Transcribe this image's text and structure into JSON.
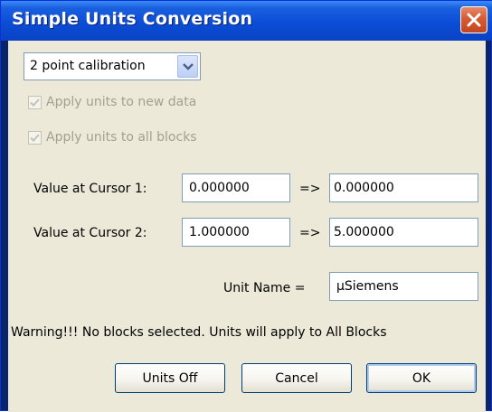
{
  "window": {
    "title": "Simple Units Conversion",
    "close_icon": "close-icon"
  },
  "calibration": {
    "selected": "2 point calibration",
    "dropdown_icon": "chevron-down-icon"
  },
  "options": {
    "apply_new_data": {
      "label": "Apply units to new data",
      "checked": true,
      "enabled": false
    },
    "apply_all_blocks": {
      "label": "Apply units to all blocks",
      "checked": true,
      "enabled": false
    }
  },
  "cursor1": {
    "label": "Value at Cursor 1:",
    "value": "0.000000",
    "arrow": "=>",
    "result": "0.000000"
  },
  "cursor2": {
    "label": "Value at Cursor 2:",
    "value": "1.000000",
    "arrow": "=>",
    "result": "5.000000"
  },
  "unit": {
    "label": "Unit Name =",
    "value": "µSiemens"
  },
  "warning": "Warning!!! No blocks selected. Units will apply to All Blocks",
  "buttons": {
    "units_off": "Units Off",
    "cancel": "Cancel",
    "ok": "OK"
  },
  "colors": {
    "titlebar": "#0b4dd6",
    "client": "#ece9d8",
    "close": "#d65a32",
    "disabled_text": "#a3a08f"
  }
}
